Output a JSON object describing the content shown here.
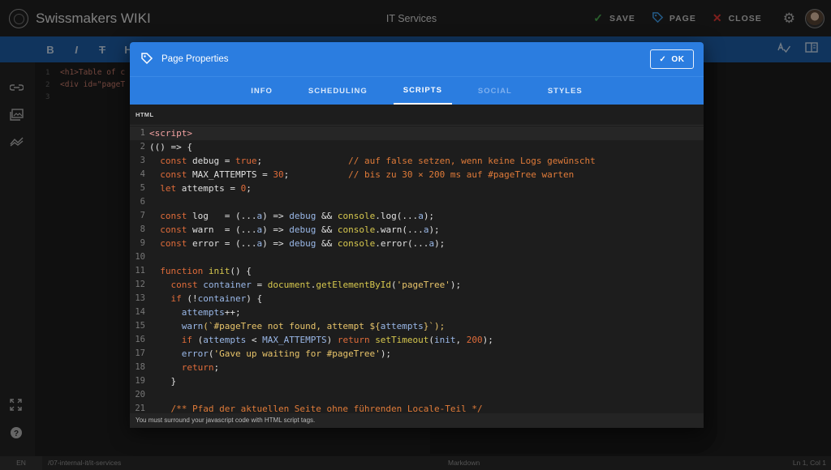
{
  "app": {
    "brand": "Swissmakers WIKI",
    "page_title": "IT Services"
  },
  "header": {
    "save_label": "SAVE",
    "page_label": "PAGE",
    "close_label": "CLOSE"
  },
  "toolbar": {
    "bold": "B",
    "italic": "I",
    "strike": "T",
    "heading": "H"
  },
  "background_editor": {
    "line_numbers": [
      "1",
      "2",
      "3"
    ],
    "line1": "<h1>Table of c",
    "line2": "<div id=\"pageT"
  },
  "dialog": {
    "title": "Page Properties",
    "ok_label": "OK",
    "tabs": [
      "INFO",
      "SCHEDULING",
      "SCRIPTS",
      "SOCIAL",
      "STYLES"
    ],
    "active_tab": "SCRIPTS",
    "section_label": "HTML",
    "hint": "You must surround your javascript code with HTML script tags."
  },
  "code": {
    "line_numbers": [
      "1",
      "2",
      "3",
      "4",
      "5",
      "6",
      "7",
      "8",
      "9",
      "10",
      "11",
      "12",
      "13",
      "14",
      "15",
      "16",
      "17",
      "18",
      "19",
      "20",
      "21"
    ],
    "l1": "<script>",
    "l2": "(() => {",
    "l3_a": "  const ",
    "l3_b": "debug",
    "l3_c": " = ",
    "l3_d": "true",
    "l3_e": ";                ",
    "l3_f": "// auf false setzen, wenn keine Logs gewünscht",
    "l4_a": "  const ",
    "l4_b": "MAX_ATTEMPTS",
    "l4_c": " = ",
    "l4_d": "30",
    "l4_e": ";           ",
    "l4_f": "// bis zu 30 × 200 ms auf #pageTree warten",
    "l5_a": "  let ",
    "l5_b": "attempts",
    "l5_c": " = ",
    "l5_d": "0",
    "l5_e": ";",
    "l7_a": "  const ",
    "l7_b": "log   = (...",
    "l7_c": "a",
    "l7_d": ") => ",
    "l7_e": "debug",
    "l7_f": " && ",
    "l7_g": "console",
    "l7_h": ".log(...",
    "l7_i": "a",
    "l7_j": ");",
    "l8_a": "  const ",
    "l8_b": "warn  = (...",
    "l8_c": "a",
    "l8_d": ") => ",
    "l8_e": "debug",
    "l8_f": " && ",
    "l8_g": "console",
    "l8_h": ".warn(...",
    "l8_i": "a",
    "l8_j": ");",
    "l9_a": "  const ",
    "l9_b": "error = (...",
    "l9_c": "a",
    "l9_d": ") => ",
    "l9_e": "debug",
    "l9_f": " && ",
    "l9_g": "console",
    "l9_h": ".error(...",
    "l9_i": "a",
    "l9_j": ");",
    "l11_a": "  function ",
    "l11_b": "init",
    "l11_c": "() {",
    "l12_a": "    const ",
    "l12_b": "container",
    "l12_c": " = ",
    "l12_d": "document",
    "l12_e": ".",
    "l12_f": "getElementById",
    "l12_g": "(",
    "l12_h": "'pageTree'",
    "l12_i": ");",
    "l13_a": "    if ",
    "l13_b": "(!",
    "l13_c": "container",
    "l13_d": ") {",
    "l14_a": "      ",
    "l14_b": "attempts",
    "l14_c": "++;",
    "l15_a": "      ",
    "l15_b": "warn",
    "l15_c": "(`#pageTree not found, attempt ${",
    "l15_d": "attempts",
    "l15_e": "}`);",
    "l16_a": "      if ",
    "l16_b": "(",
    "l16_c": "attempts",
    "l16_d": " < ",
    "l16_e": "MAX_ATTEMPTS",
    "l16_f": ") ",
    "l16_g": "return ",
    "l16_h": "setTimeout",
    "l16_i": "(",
    "l16_j": "init",
    "l16_k": ", ",
    "l16_l": "200",
    "l16_m": ");",
    "l17_a": "      ",
    "l17_b": "error",
    "l17_c": "(",
    "l17_d": "'Gave up waiting for #pageTree'",
    "l17_e": ");",
    "l18_a": "      return",
    "l18_b": ";",
    "l19": "    }",
    "l21": "    /** Pfad der aktuellen Seite ohne führenden Locale-Teil */"
  },
  "statusbar": {
    "lang": "EN",
    "path": "/07-internal-it/it-services",
    "mode": "Markdown",
    "position": "Ln 1, Col 1"
  },
  "colors": {
    "toolbar_blue": "#1e5fa9",
    "dialog_blue": "#2b7de0",
    "save_green": "#4caf50",
    "close_red": "#e53935"
  },
  "icons": [
    "app-logo-icon",
    "check-icon",
    "tag-icon",
    "x-icon",
    "gear-icon",
    "link-icon",
    "image-icon",
    "chart-icon",
    "expand-icon",
    "help-icon",
    "spellcheck-icon",
    "split-view-icon"
  ]
}
